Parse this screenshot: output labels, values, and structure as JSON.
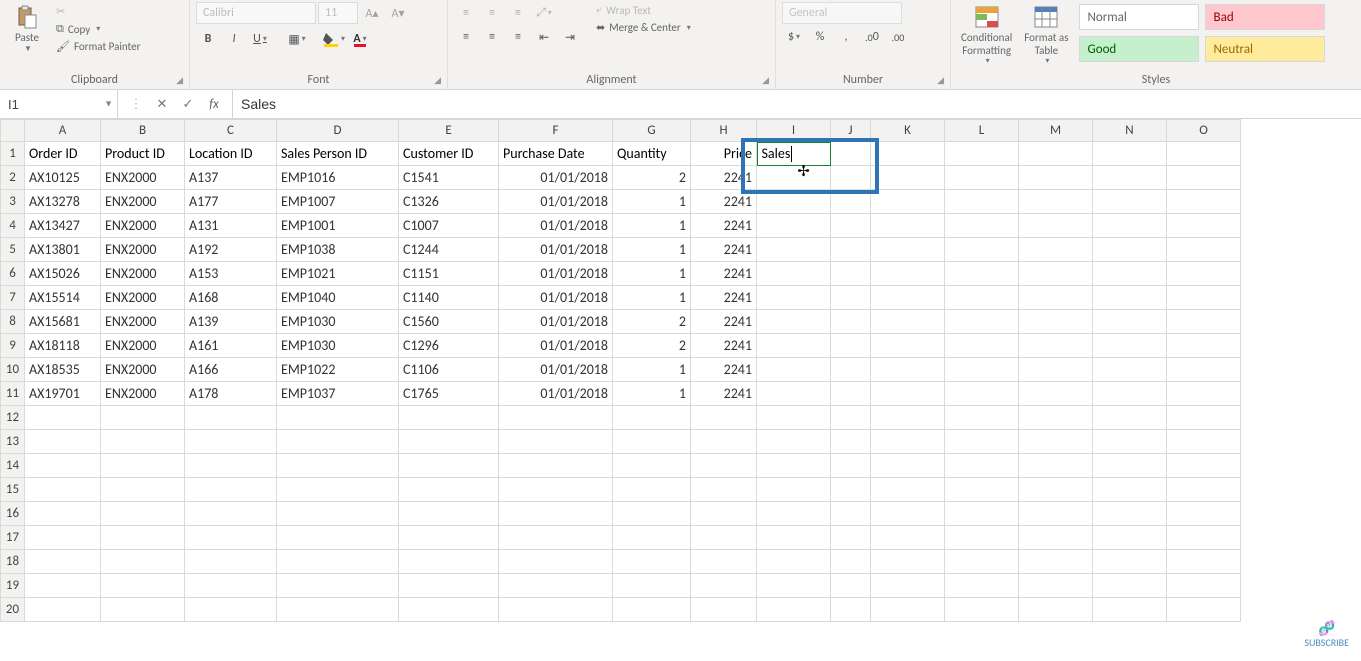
{
  "ribbon": {
    "paste": "Paste",
    "copy": "Copy",
    "format_painter": "Format Painter",
    "clipboard_label": "Clipboard",
    "font_name": "Calibri",
    "font_size": "11",
    "font_label": "Font",
    "wrap_text": "Wrap Text",
    "merge": "Merge & Center",
    "alignment_label": "Alignment",
    "number_format": "General",
    "number_label": "Number",
    "cond_fmt": "Conditional\nFormatting",
    "fmt_table": "Format as\nTable",
    "style_normal": "Normal",
    "style_bad": "Bad",
    "style_good": "Good",
    "style_neutral": "Neutral",
    "styles_label": "Styles"
  },
  "formula_bar": {
    "name_box": "I1",
    "formula": "Sales"
  },
  "columns": [
    "A",
    "B",
    "C",
    "D",
    "E",
    "F",
    "G",
    "H",
    "I",
    "J",
    "K",
    "L",
    "M",
    "N",
    "O"
  ],
  "col_css": [
    "cA",
    "cB",
    "cC",
    "cD",
    "cE",
    "cF",
    "cG",
    "cH",
    "cI",
    "cJ",
    "cK",
    "cL",
    "cM",
    "cN",
    "cO"
  ],
  "header_row": [
    "Order ID",
    "Product ID",
    "Location ID",
    "Sales Person ID",
    "Customer ID",
    "Purchase Date",
    "Quantity",
    "Price",
    "Sales",
    "",
    "",
    "",
    "",
    "",
    ""
  ],
  "header_align": [
    "lf",
    "lf",
    "lf",
    "lf",
    "lf",
    "lf",
    "lf",
    "num",
    "lf",
    "",
    "",
    "",
    "",
    "",
    ""
  ],
  "data_rows": [
    [
      "AX10125",
      "ENX2000",
      "A137",
      "EMP1016",
      "C1541",
      "01/01/2018",
      "2",
      "2241"
    ],
    [
      "AX13278",
      "ENX2000",
      "A177",
      "EMP1007",
      "C1326",
      "01/01/2018",
      "1",
      "2241"
    ],
    [
      "AX13427",
      "ENX2000",
      "A131",
      "EMP1001",
      "C1007",
      "01/01/2018",
      "1",
      "2241"
    ],
    [
      "AX13801",
      "ENX2000",
      "A192",
      "EMP1038",
      "C1244",
      "01/01/2018",
      "1",
      "2241"
    ],
    [
      "AX15026",
      "ENX2000",
      "A153",
      "EMP1021",
      "C1151",
      "01/01/2018",
      "1",
      "2241"
    ],
    [
      "AX15514",
      "ENX2000",
      "A168",
      "EMP1040",
      "C1140",
      "01/01/2018",
      "1",
      "2241"
    ],
    [
      "AX15681",
      "ENX2000",
      "A139",
      "EMP1030",
      "C1560",
      "01/01/2018",
      "2",
      "2241"
    ],
    [
      "AX18118",
      "ENX2000",
      "A161",
      "EMP1030",
      "C1296",
      "01/01/2018",
      "2",
      "2241"
    ],
    [
      "AX18535",
      "ENX2000",
      "A166",
      "EMP1022",
      "C1106",
      "01/01/2018",
      "1",
      "2241"
    ],
    [
      "AX19701",
      "ENX2000",
      "A178",
      "EMP1037",
      "C1765",
      "01/01/2018",
      "1",
      "2241"
    ]
  ],
  "align": [
    "lf",
    "lf",
    "lf",
    "lf",
    "lf",
    "date",
    "num",
    "num"
  ],
  "empty_rows": 9,
  "active_cell": "I1",
  "subscribe": "SUBSCRIBE",
  "chart_data": {
    "type": "table",
    "columns": [
      "Order ID",
      "Product ID",
      "Location ID",
      "Sales Person ID",
      "Customer ID",
      "Purchase Date",
      "Quantity",
      "Price",
      "Sales"
    ],
    "rows": [
      [
        "AX10125",
        "ENX2000",
        "A137",
        "EMP1016",
        "C1541",
        "01/01/2018",
        2,
        2241,
        null
      ],
      [
        "AX13278",
        "ENX2000",
        "A177",
        "EMP1007",
        "C1326",
        "01/01/2018",
        1,
        2241,
        null
      ],
      [
        "AX13427",
        "ENX2000",
        "A131",
        "EMP1001",
        "C1007",
        "01/01/2018",
        1,
        2241,
        null
      ],
      [
        "AX13801",
        "ENX2000",
        "A192",
        "EMP1038",
        "C1244",
        "01/01/2018",
        1,
        2241,
        null
      ],
      [
        "AX15026",
        "ENX2000",
        "A153",
        "EMP1021",
        "C1151",
        "01/01/2018",
        1,
        2241,
        null
      ],
      [
        "AX15514",
        "ENX2000",
        "A168",
        "EMP1040",
        "C1140",
        "01/01/2018",
        1,
        2241,
        null
      ],
      [
        "AX15681",
        "ENX2000",
        "A139",
        "EMP1030",
        "C1560",
        "01/01/2018",
        2,
        2241,
        null
      ],
      [
        "AX18118",
        "ENX2000",
        "A161",
        "EMP1030",
        "C1296",
        "01/01/2018",
        2,
        2241,
        null
      ],
      [
        "AX18535",
        "ENX2000",
        "A166",
        "EMP1022",
        "C1106",
        "01/01/2018",
        1,
        2241,
        null
      ],
      [
        "AX19701",
        "ENX2000",
        "A178",
        "EMP1037",
        "C1765",
        "01/01/2018",
        1,
        2241,
        null
      ]
    ]
  }
}
